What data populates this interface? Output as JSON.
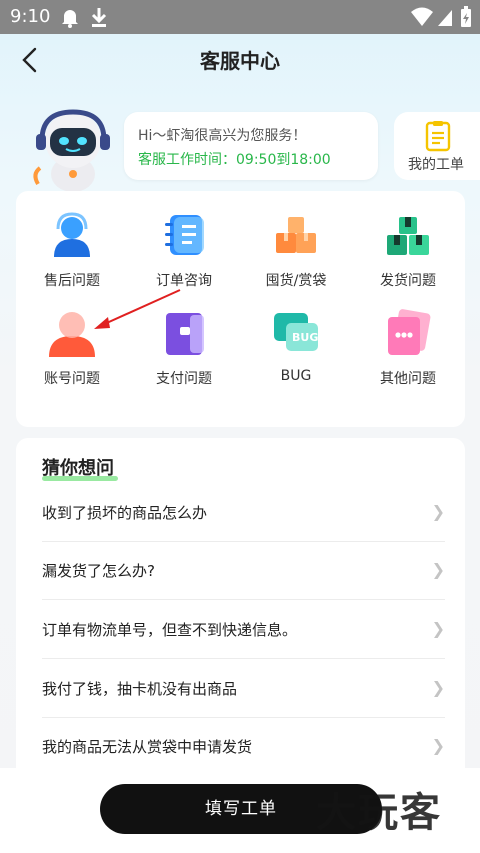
{
  "status_bar": {
    "time": "9:10"
  },
  "nav": {
    "title": "客服中心"
  },
  "greeting": {
    "line1": "Hi～虾淘很高兴为您服务！",
    "line2": "客服工作时间：09:50到18:00",
    "hours_color": "#29b74a"
  },
  "ticket": {
    "label": "我的工单"
  },
  "categories": [
    {
      "label": "售后问题",
      "icon": "headset-person-icon"
    },
    {
      "label": "订单咨询",
      "icon": "notebook-icon"
    },
    {
      "label": "囤货/赏袋",
      "icon": "boxes-icon"
    },
    {
      "label": "发货问题",
      "icon": "gift-boxes-icon"
    },
    {
      "label": "账号问题",
      "icon": "user-account-icon"
    },
    {
      "label": "支付问题",
      "icon": "wallet-icon"
    },
    {
      "label": "BUG",
      "icon": "bug-cards-icon"
    },
    {
      "label": "其他问题",
      "icon": "chat-bubble-icon"
    }
  ],
  "bug_icon_text": "BUG",
  "guess": {
    "title": "猜你想问",
    "questions": [
      "收到了损坏的商品怎么办",
      "漏发货了怎么办?",
      "订单有物流单号，但查不到快递信息。",
      "我付了钱，抽卡机没有出商品",
      "我的商品无法从赏袋中申请发货"
    ]
  },
  "submit": {
    "label": "填写工单"
  },
  "watermark": "大玩客"
}
